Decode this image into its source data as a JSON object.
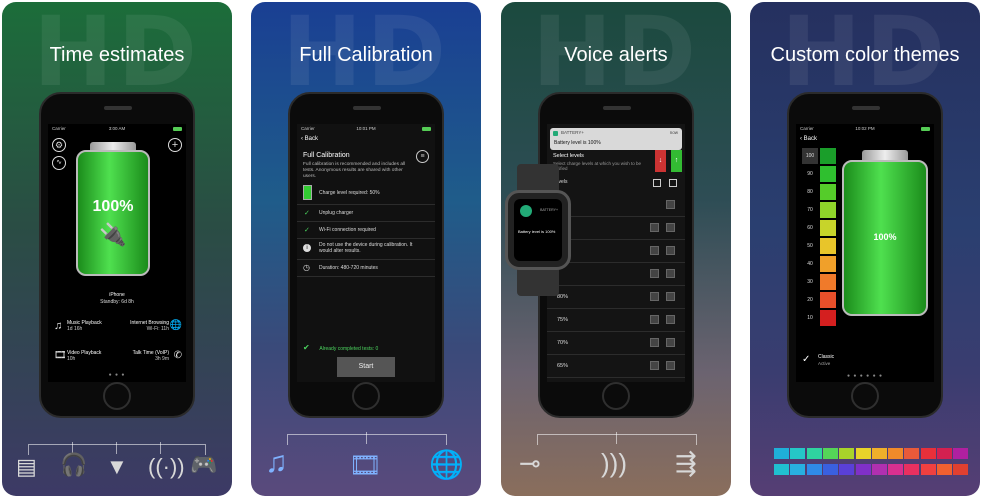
{
  "panels": [
    {
      "bg_text": "HD",
      "title": "Time estimates",
      "status": {
        "carrier": "Carrier",
        "time": "3:00 AM"
      },
      "battery_percent": "100%",
      "device": "iPhone",
      "standby": "Standby: 6d 8h",
      "estimates": [
        {
          "label": "Music Playback",
          "value": "1d 16h"
        },
        {
          "label": "Internet Browsing",
          "value": "Wi-Fi: 11h"
        },
        {
          "label": "Video Playback",
          "value": "10h"
        },
        {
          "label": "Talk Time (VoIP)",
          "value": "3h 9m"
        }
      ]
    },
    {
      "bg_text": "HD",
      "title": "Full Calibration",
      "status": {
        "carrier": "Carrier",
        "time": "10:01 PM"
      },
      "back": "Back",
      "heading": "Full Calibration",
      "desc": "Full calibration is recommended and includes all tests. Anonymous results are shared with other users.",
      "charge": "Charge level required: 50%",
      "steps": [
        "Unplug charger",
        "Wi-Fi connection required",
        "Do not use the device during calibration. It would alter results.",
        "Duration: 480-720 minutes"
      ],
      "completed": "Already completed tests: 0",
      "start": "Start"
    },
    {
      "bg_text": "HD",
      "title": "Voice alerts",
      "notif_app": "BATTERY+",
      "notif_time": "now",
      "notif_text": "Battery level is 100%",
      "select_title": "Select levels",
      "select_desc": "Select charge levels at which you wish to be notified",
      "watch_app": "BATTERY+",
      "watch_text": "Battery level is 100%",
      "levels_label": "Levels",
      "levels": [
        "80%",
        "75%",
        "70%",
        "65%"
      ]
    },
    {
      "bg_text": "HD",
      "title": "Custom color themes",
      "status": {
        "carrier": "Carrier",
        "time": "10:02 PM"
      },
      "back": "Back",
      "scale": [
        "100",
        "90",
        "80",
        "70",
        "60",
        "50",
        "40",
        "30",
        "20",
        "10"
      ],
      "battery_percent": "100%",
      "theme_name": "Classic",
      "theme_state": "Active"
    }
  ],
  "colors": {
    "green": "#2fd43a",
    "scale": [
      "#1a9e2a",
      "#2fbf2f",
      "#55cc2a",
      "#8fd42a",
      "#c7d42a",
      "#e8c52a",
      "#f0a02a",
      "#f07a2a",
      "#e8502a",
      "#d41f1f"
    ],
    "palette_top": [
      "#1fb0d8",
      "#25c7c7",
      "#2fd4a0",
      "#55d458",
      "#a8d42a",
      "#e8d42a",
      "#f0b02a",
      "#f08a2a",
      "#e85a3a",
      "#e8303a",
      "#d42050",
      "#b020a0"
    ],
    "palette_bottom": [
      "#20c0d0",
      "#28b0e0",
      "#2f8ae8",
      "#3a60e0",
      "#5a40d8",
      "#8030c8",
      "#b030b0",
      "#d83090",
      "#e83060",
      "#f04040",
      "#f06030",
      "#e04030"
    ]
  },
  "icons": {
    "panel1_row": [
      "film-icon",
      "headphones-icon",
      "flashlight-icon",
      "antenna-icon",
      "gamepad-icon"
    ],
    "panel2_row": [
      "music-note-icon",
      "film-icon",
      "globe-icon"
    ],
    "panel3_row": [
      "plug-icon",
      "wireless-icon",
      "usb-icon"
    ]
  }
}
